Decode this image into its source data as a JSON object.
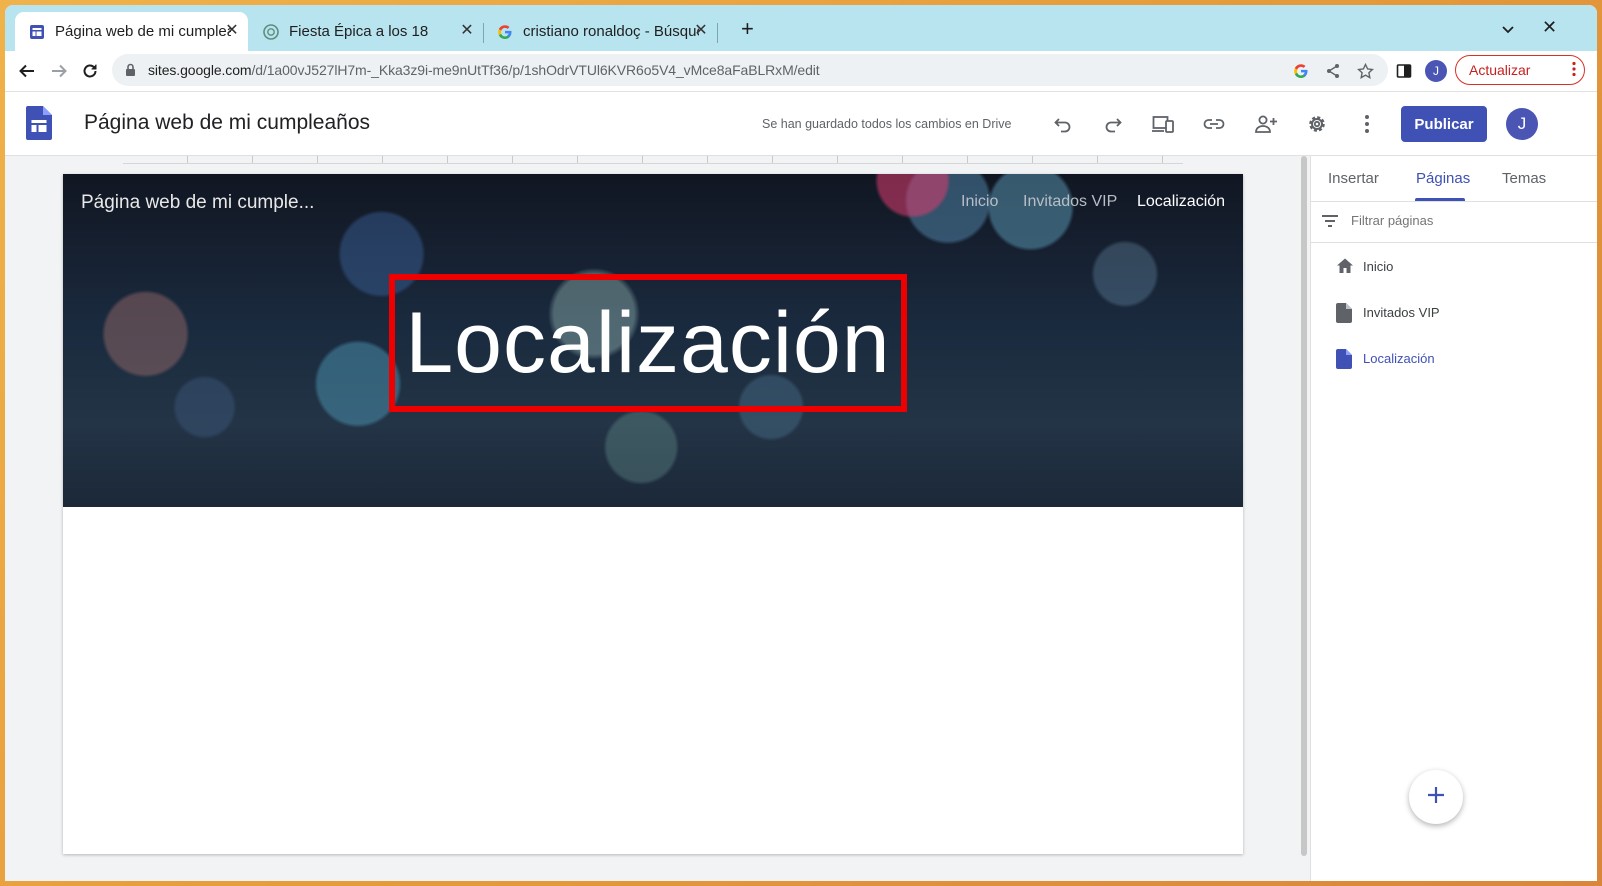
{
  "browser": {
    "tabs": [
      {
        "title": "Página web de mi cumpleaños",
        "favicon": "google-sites-icon",
        "active": true
      },
      {
        "title": "Fiesta Épica a los 18",
        "favicon": "chatgpt-icon",
        "active": false
      },
      {
        "title": "cristiano ronaldoç - Búsqueda",
        "favicon": "google-icon",
        "active": false
      }
    ],
    "url_host": "sites.google.com",
    "url_path": "/d/1a00vJ527lH7m-_Kka3z9i-me9nUtTf36/p/1shOdrVTUl6KVR6o5V4_vMce8aFaBLRxM/edit",
    "profile_initial": "J",
    "update_label": "Actualizar"
  },
  "sites": {
    "doc_title": "Página web de mi cumpleaños",
    "save_status": "Se han guardado todos los cambios en Drive",
    "publish_label": "Publicar",
    "avatar_initial": "J",
    "accent_color": "#3f51b5"
  },
  "hero": {
    "site_name": "Página web de mi cumple...",
    "nav": [
      "Inicio",
      "Invitados VIP",
      "Localización"
    ],
    "active_nav": "Localización",
    "title": "Localización",
    "highlight_color": "#ee0000"
  },
  "side_panel": {
    "tabs": [
      "Insertar",
      "Páginas",
      "Temas"
    ],
    "active_tab": "Páginas",
    "filter_placeholder": "Filtrar páginas",
    "pages": [
      {
        "label": "Inicio",
        "icon": "home-icon"
      },
      {
        "label": "Invitados VIP",
        "icon": "page-icon"
      },
      {
        "label": "Localización",
        "icon": "page-icon",
        "active": true
      }
    ]
  }
}
